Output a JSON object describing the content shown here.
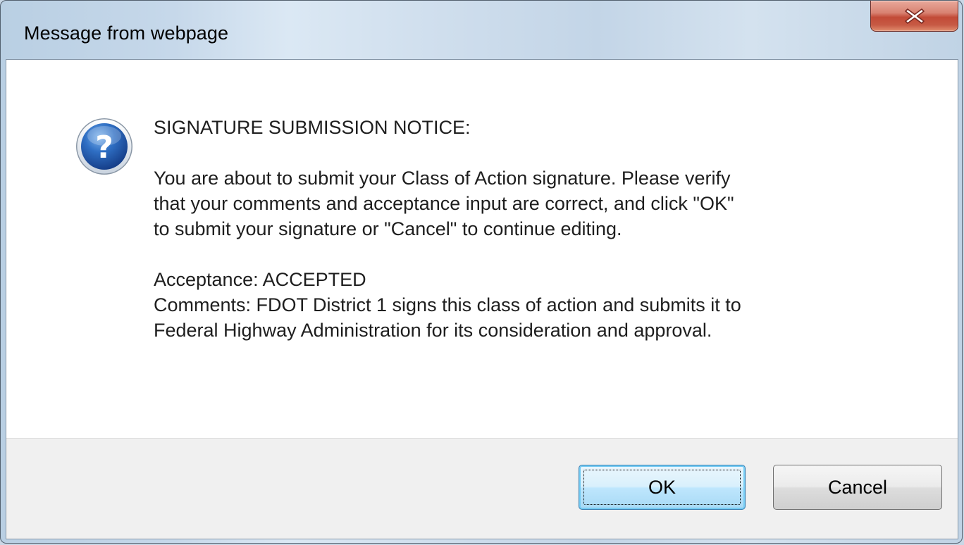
{
  "window": {
    "title": "Message from webpage"
  },
  "icons": {
    "close": "close-icon",
    "question": "question-icon"
  },
  "message": {
    "heading": "SIGNATURE SUBMISSION NOTICE:",
    "body_lines": [
      "You are about to submit your Class of Action signature.  Please verify",
      "that your comments and acceptance input are correct, and click \"OK\"",
      "to submit your signature or \"Cancel\" to continue editing."
    ],
    "detail_lines": [
      "Acceptance: ACCEPTED",
      "Comments: FDOT District 1 signs this class of action and submits it to",
      "Federal Highway Administration for its consideration and approval."
    ]
  },
  "buttons": {
    "ok_label": "OK",
    "cancel_label": "Cancel"
  },
  "colors": {
    "close_button": "#c75a44",
    "ok_button_border": "#3c7fb1",
    "question_icon": "#2a5fb0",
    "button_area": "#f0f0f0"
  }
}
